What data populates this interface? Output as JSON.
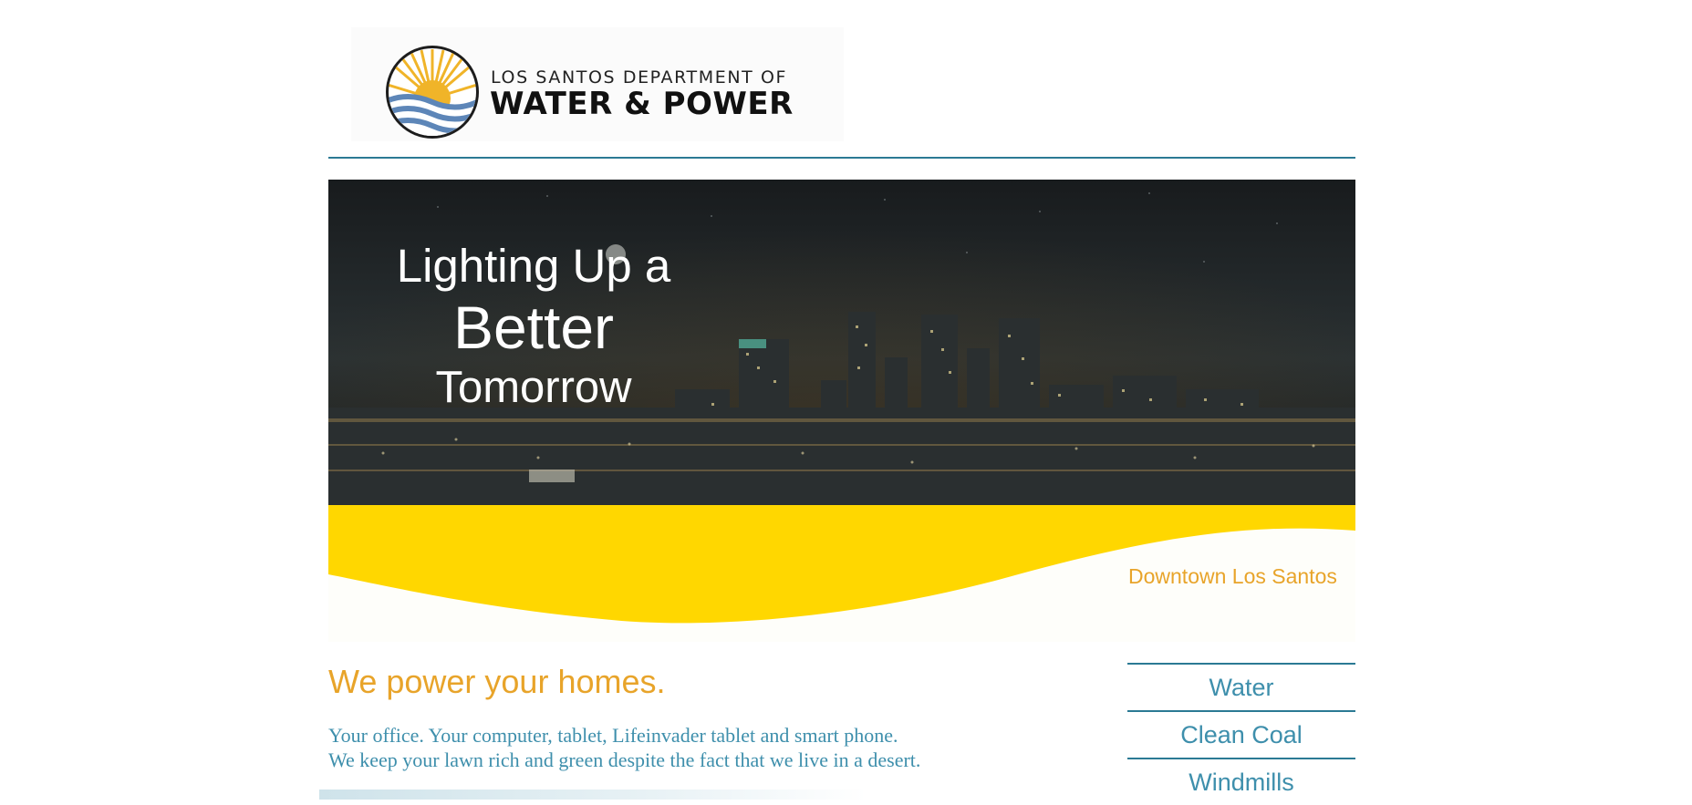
{
  "header": {
    "logo": {
      "line1": "LOS SANTOS DEPARTMENT OF",
      "line2": "WATER & POWER",
      "icon": "sun-over-waves-logo"
    }
  },
  "hero": {
    "line1": "Lighting Up a",
    "line2": "Better",
    "line3": "Tomorrow",
    "caption": "Downtown Los Santos"
  },
  "main": {
    "heading": "We power your homes.",
    "paragraph_lines": [
      "Your office. Your computer, tablet, Lifeinvader tablet and smart phone.",
      "We keep your lawn rich and green despite the fact that we live in a desert."
    ]
  },
  "sidebar": {
    "items": [
      {
        "label": "Water"
      },
      {
        "label": "Clean Coal"
      },
      {
        "label": "Windmills"
      }
    ]
  },
  "colors": {
    "accent_teal": "#2b7a94",
    "link_blue": "#3e8fac",
    "accent_orange": "#e8a42a",
    "wave_yellow": "#ffd700",
    "hero_sky": "#1c2023"
  }
}
